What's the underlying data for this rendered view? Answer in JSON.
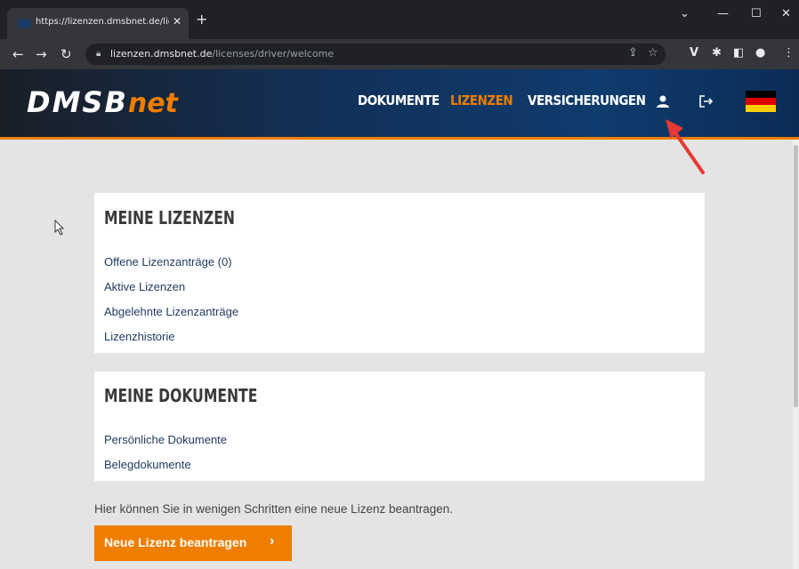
{
  "browser": {
    "tab_title": "https://lizenzen.dmsbnet.de/licen",
    "url_host": "lizenzen.dmsbnet.de",
    "url_path": "/licenses/driver/welcome"
  },
  "site": {
    "logo_main": "DMSB",
    "logo_suffix": "net",
    "nav": {
      "dokumente": "DOKUMENTE",
      "lizenzen": "LIZENZEN",
      "versicherungen": "VERSICHERUNGEN"
    },
    "accent_color": "#ef7d00",
    "header_color": "#0f3c6e"
  },
  "licenses_card": {
    "title": "MEINE LIZENZEN",
    "links": [
      "Offene Lizenzanträge (0)",
      "Aktive Lizenzen",
      "Abgelehnte Lizenzanträge",
      "Lizenzhistorie"
    ]
  },
  "documents_card": {
    "title": "MEINE DOKUMENTE",
    "links": [
      "Persönliche Dokumente",
      "Belegdokumente"
    ]
  },
  "info_text": "Hier können Sie in wenigen Schritten eine neue Lizenz beantragen.",
  "cta": {
    "label": "Neue Lizenz beantragen",
    "chevron": "›"
  }
}
